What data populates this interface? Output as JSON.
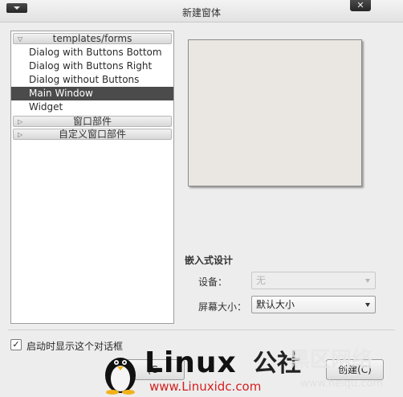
{
  "window": {
    "title": "新建窗体",
    "close_glyph": "✕"
  },
  "tree": {
    "sections": [
      {
        "label": "templates/forms",
        "expanded": true,
        "items": [
          "Dialog with Buttons Bottom",
          "Dialog with Buttons Right",
          "Dialog without Buttons",
          "Main Window",
          "Widget"
        ],
        "selected": "Main Window"
      },
      {
        "label": "窗口部件",
        "expanded": false
      },
      {
        "label": "自定义窗口部件",
        "expanded": false
      }
    ]
  },
  "embedded": {
    "title": "嵌入式设计",
    "device_label": "设备：",
    "device_value": "无",
    "device_enabled": false,
    "screen_label": "屏幕大小：",
    "screen_value": "默认大小"
  },
  "footer": {
    "checkbox_label": "启动时显示这个对话框",
    "checkbox_checked": true,
    "left_button": "(C",
    "right_button": "创建(C)"
  },
  "watermark": {
    "linux": "Linux",
    "she": "公社",
    "url": "www.Linuxidc.com",
    "hei": "黑区网络",
    "hei_url": "www.heiqu.com"
  },
  "colors": {
    "selected_bg": "#4b4b4b",
    "watermark_url": "#d32020"
  }
}
